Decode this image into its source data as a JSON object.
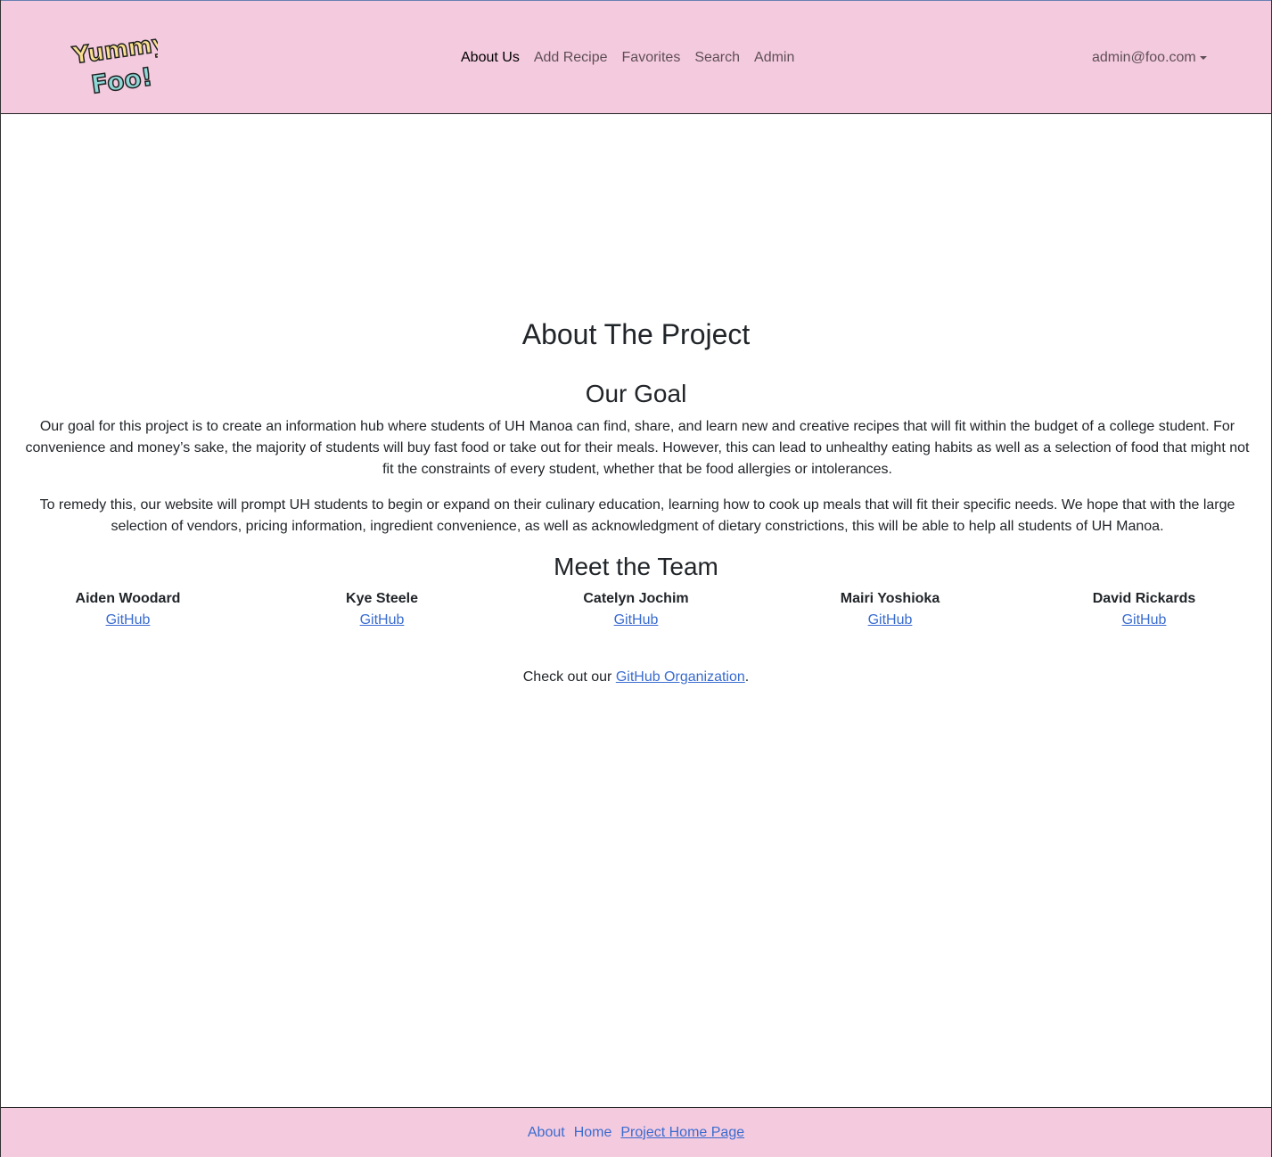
{
  "header": {
    "logo_text_top": "Yummy",
    "logo_text_bottom": "Foo!",
    "nav": [
      {
        "label": "About Us",
        "active": true
      },
      {
        "label": "Add Recipe"
      },
      {
        "label": "Favorites"
      },
      {
        "label": "Search"
      },
      {
        "label": "Admin"
      }
    ],
    "user": "admin@foo.com"
  },
  "main": {
    "title": "About The Project",
    "goal_heading": "Our Goal",
    "goal_p1": "Our goal for this project is to create an information hub where students of UH Manoa can find, share, and learn new and creative recipes that will fit within the budget of a college student. For convenience and money’s sake, the majority of students will buy fast food or take out for their meals. However, this can lead to unhealthy eating habits as well as a selection of food that might not fit the constraints of every student, whether that be food allergies or intolerances.",
    "goal_p2": "To remedy this, our website will prompt UH students to begin or expand on their culinary education, learning how to cook up meals that will fit their specific needs. We hope that with the large selection of vendors, pricing information, ingredient convenience, as well as acknowledgment of dietary constrictions, this will be able to help all students of UH Manoa.",
    "team_heading": "Meet the Team",
    "team": [
      {
        "name": "Aiden Woodard",
        "link": "GitHub"
      },
      {
        "name": "Kye Steele",
        "link": "GitHub"
      },
      {
        "name": "Catelyn Jochim",
        "link": "GitHub"
      },
      {
        "name": "Mairi Yoshioka",
        "link": "GitHub"
      },
      {
        "name": "David Rickards",
        "link": "GitHub"
      }
    ],
    "org_prefix": "Check out our ",
    "org_link": "GitHub Organization",
    "org_suffix": "."
  },
  "footer": {
    "links": [
      "About",
      "Home",
      "Project Home Page"
    ]
  },
  "colors": {
    "navbar_bg": "#f4cade",
    "link": "#3a6cd0",
    "logo_yellow": "#f9e08f",
    "logo_teal": "#8fd8d8"
  }
}
